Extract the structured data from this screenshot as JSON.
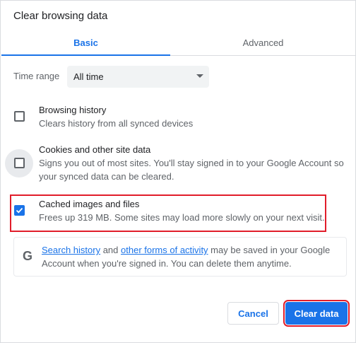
{
  "dialog": {
    "title": "Clear browsing data"
  },
  "tabs": [
    {
      "label": "Basic",
      "selected": true
    },
    {
      "label": "Advanced",
      "selected": false
    }
  ],
  "time_range": {
    "label": "Time range",
    "value": "All time"
  },
  "items": [
    {
      "title": "Browsing history",
      "desc": "Clears history from all synced devices",
      "checked": false
    },
    {
      "title": "Cookies and other site data",
      "desc": "Signs you out of most sites. You'll stay signed in to your Google Account so your synced data can be cleared.",
      "checked": false
    },
    {
      "title": "Cached images and files",
      "desc": "Frees up 319 MB. Some sites may load more slowly on your next visit.",
      "checked": true
    }
  ],
  "info": {
    "link1": "Search history",
    "mid1": " and ",
    "link2": "other forms of activity",
    "rest": " may be saved in your Google Account when you're signed in. You can delete them anytime."
  },
  "buttons": {
    "cancel": "Cancel",
    "clear": "Clear data"
  },
  "colors": {
    "accent": "#1a73e8",
    "highlight": "#e11d2a"
  },
  "icons": {
    "logo": "google-g-icon",
    "dropdown": "caret-down-icon",
    "check": "checkmark-icon"
  }
}
